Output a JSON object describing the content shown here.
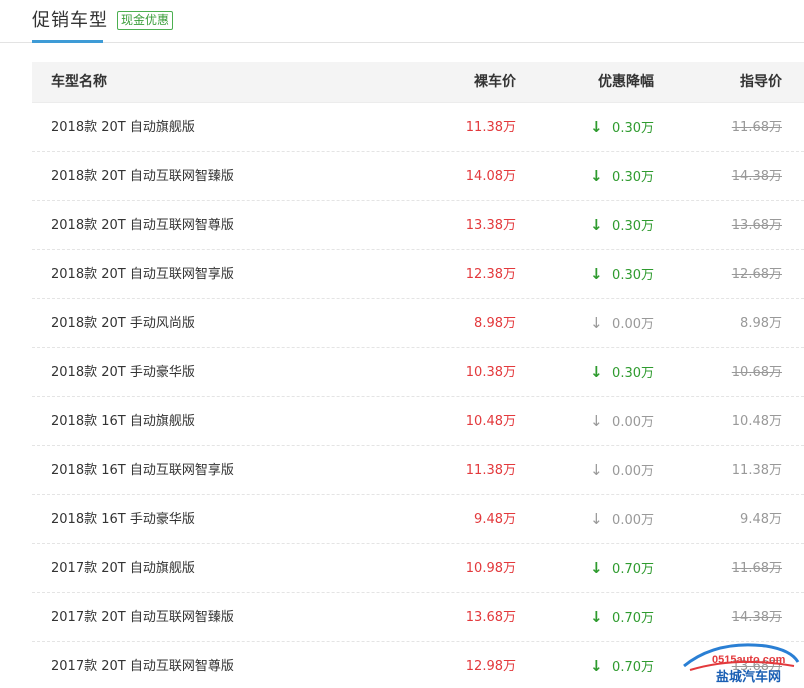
{
  "tab": {
    "title": "促销车型",
    "tag": "现金优惠"
  },
  "table": {
    "headers": {
      "name": "车型名称",
      "price": "裸车价",
      "discount": "优惠降幅",
      "guide": "指导价"
    },
    "rows": [
      {
        "name": "2018款 20T 自动旗舰版",
        "price": "11.38万",
        "discount": "0.30万",
        "guide": "11.68万",
        "has_discount": true
      },
      {
        "name": "2018款 20T 自动互联网智臻版",
        "price": "14.08万",
        "discount": "0.30万",
        "guide": "14.38万",
        "has_discount": true
      },
      {
        "name": "2018款 20T 自动互联网智尊版",
        "price": "13.38万",
        "discount": "0.30万",
        "guide": "13.68万",
        "has_discount": true
      },
      {
        "name": "2018款 20T 自动互联网智享版",
        "price": "12.38万",
        "discount": "0.30万",
        "guide": "12.68万",
        "has_discount": true
      },
      {
        "name": "2018款 20T 手动风尚版",
        "price": "8.98万",
        "discount": "0.00万",
        "guide": "8.98万",
        "has_discount": false
      },
      {
        "name": "2018款 20T 手动豪华版",
        "price": "10.38万",
        "discount": "0.30万",
        "guide": "10.68万",
        "has_discount": true
      },
      {
        "name": "2018款 16T 自动旗舰版",
        "price": "10.48万",
        "discount": "0.00万",
        "guide": "10.48万",
        "has_discount": false
      },
      {
        "name": "2018款 16T 自动互联网智享版",
        "price": "11.38万",
        "discount": "0.00万",
        "guide": "11.38万",
        "has_discount": false
      },
      {
        "name": "2018款 16T 手动豪华版",
        "price": "9.48万",
        "discount": "0.00万",
        "guide": "9.48万",
        "has_discount": false
      },
      {
        "name": "2017款 20T 自动旗舰版",
        "price": "10.98万",
        "discount": "0.70万",
        "guide": "11.68万",
        "has_discount": true
      },
      {
        "name": "2017款 20T 自动互联网智臻版",
        "price": "13.68万",
        "discount": "0.70万",
        "guide": "14.38万",
        "has_discount": true
      },
      {
        "name": "2017款 20T 自动互联网智尊版",
        "price": "12.98万",
        "discount": "0.70万",
        "guide": "13.68万",
        "has_discount": true
      }
    ]
  },
  "watermark": {
    "domain": "0515auto.com",
    "name": "盐城汽车网"
  },
  "colors": {
    "price": "#e3393c",
    "discount": "#2f9b2f",
    "muted": "#999999",
    "tab_accent": "#3e9bd6"
  },
  "icons": {
    "discount_arrow": "down-arrow-icon"
  }
}
